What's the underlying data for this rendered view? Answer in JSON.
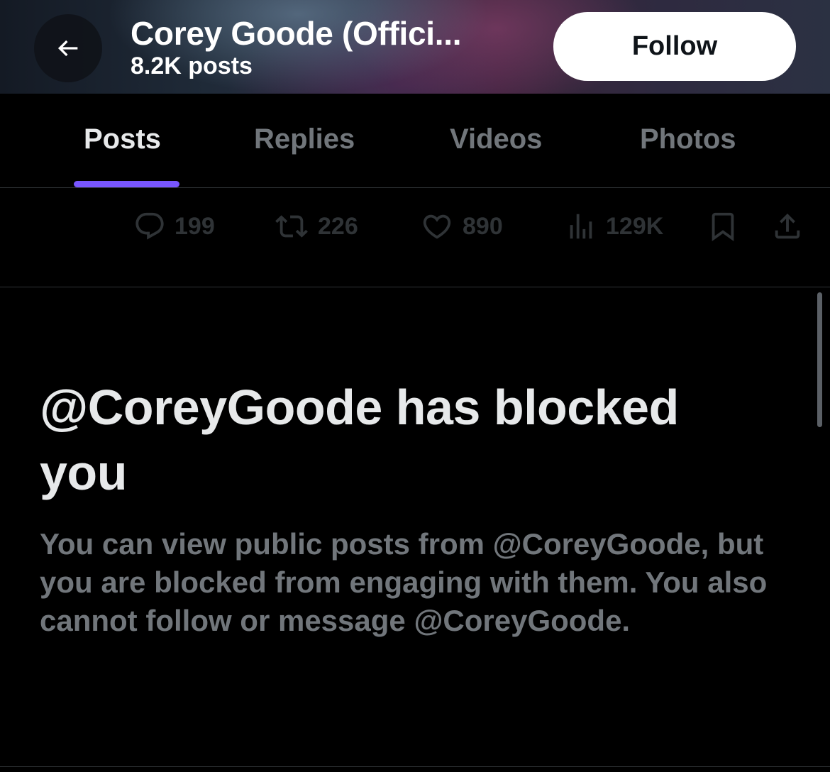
{
  "header": {
    "back_icon": "arrow-left-icon",
    "title": "Corey Goode (Offici...",
    "posts_count": "8.2K posts",
    "follow_label": "Follow"
  },
  "tabs": [
    {
      "label": "Posts",
      "active": true
    },
    {
      "label": "Replies",
      "active": false
    },
    {
      "label": "Videos",
      "active": false
    },
    {
      "label": "Photos",
      "active": false
    }
  ],
  "accent_color": "#7856ff",
  "actions": {
    "replies": {
      "icon": "reply-icon",
      "count": "199"
    },
    "reposts": {
      "icon": "repost-icon",
      "count": "226"
    },
    "likes": {
      "icon": "heart-icon",
      "count": "890"
    },
    "views": {
      "icon": "views-icon",
      "count": "129K"
    },
    "bookmark": {
      "icon": "bookmark-icon"
    },
    "share": {
      "icon": "share-icon"
    }
  },
  "blocked": {
    "title": "@CoreyGoode has blocked you",
    "body": "You can view public posts from @CoreyGoode, but you are blocked from engaging with them. You also cannot follow or message @CoreyGoode."
  }
}
